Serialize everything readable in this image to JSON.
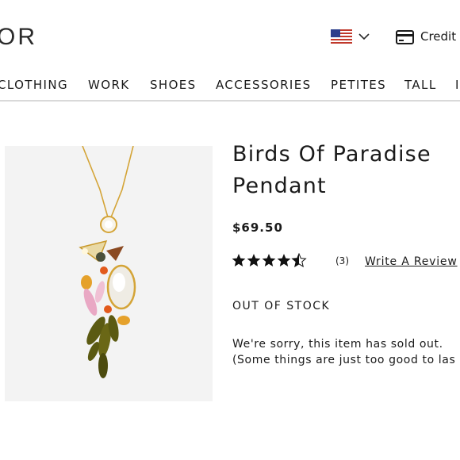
{
  "header": {
    "logo_text": "OR",
    "region_flag_icon": "us-flag-icon",
    "region_menu_icon": "chevron-down-icon",
    "credit_icon": "credit-card-icon",
    "credit_label": "Credit"
  },
  "nav": {
    "items": [
      "CLOTHING",
      "WORK",
      "SHOES",
      "ACCESSORIES",
      "PETITES",
      "TALL",
      "I"
    ]
  },
  "product": {
    "title_line1": "Birds Of Paradise",
    "title_line2": "Pendant",
    "price": "$69.50",
    "rating": 4.5,
    "rating_max": 5,
    "review_count": "(3)",
    "write_review_label": "Write A Review",
    "availability": "OUT OF STOCK",
    "message_line1": "We're sorry, this item has sold out.",
    "message_line2": "(Some things are just too good to las"
  },
  "colors": {
    "background": "#ffffff",
    "text": "#1a1a1a",
    "nav_divider": "#d9d9d9",
    "image_background": "#f3f3f3"
  }
}
